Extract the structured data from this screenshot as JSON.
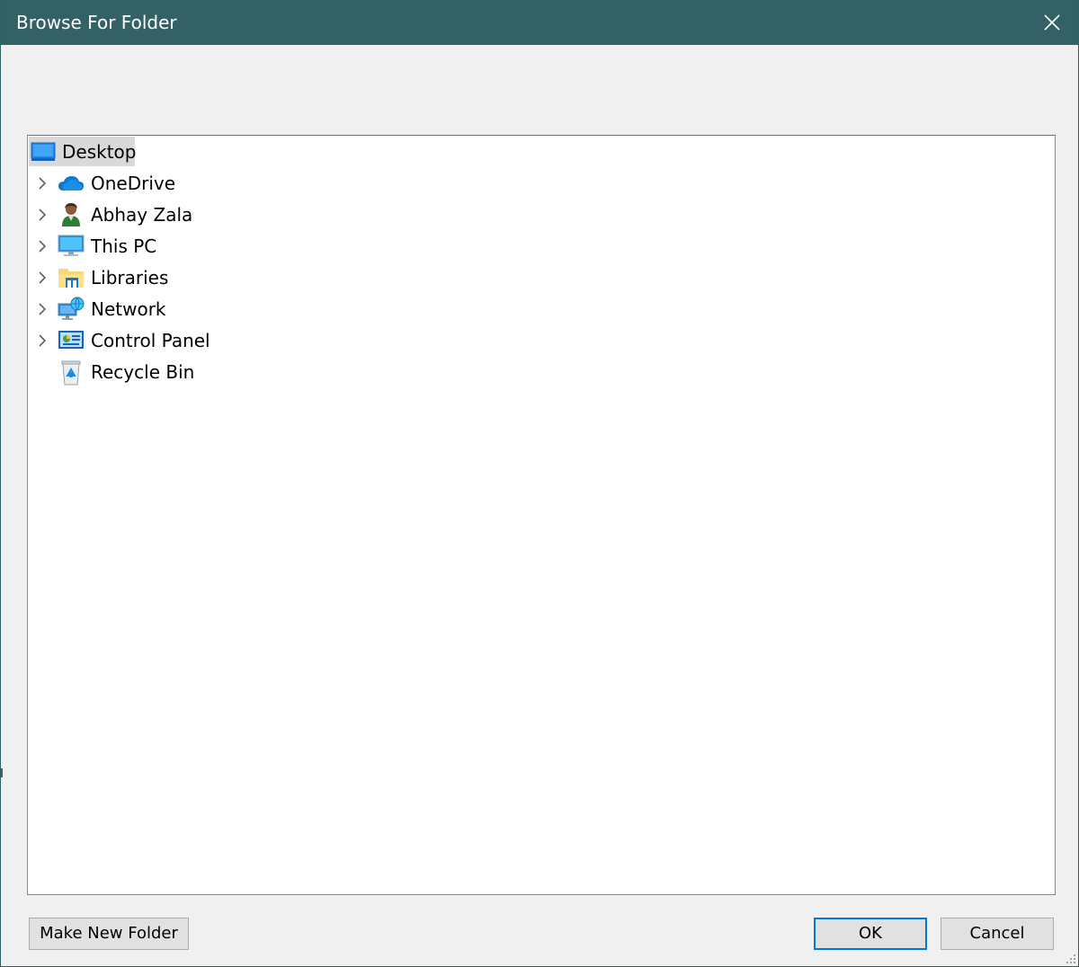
{
  "window": {
    "title": "Browse For Folder",
    "titlebar_color": "#346166"
  },
  "tree": {
    "root": {
      "label": "Desktop",
      "icon": "desktop-icon",
      "selected": true
    },
    "items": [
      {
        "label": "OneDrive",
        "icon": "onedrive-cloud-icon",
        "expandable": true
      },
      {
        "label": "Abhay Zala",
        "icon": "user-icon",
        "expandable": true
      },
      {
        "label": "This PC",
        "icon": "monitor-icon",
        "expandable": true
      },
      {
        "label": "Libraries",
        "icon": "libraries-folder-icon",
        "expandable": true
      },
      {
        "label": "Network",
        "icon": "network-icon",
        "expandable": true
      },
      {
        "label": "Control Panel",
        "icon": "control-panel-icon",
        "expandable": true
      },
      {
        "label": "Recycle Bin",
        "icon": "recycle-bin-icon",
        "expandable": false
      }
    ]
  },
  "buttons": {
    "make_new_folder": "Make New Folder",
    "ok": "OK",
    "cancel": "Cancel"
  },
  "colors": {
    "accent": "#0078d7",
    "selection": "#d9d9d9",
    "dialog_bg": "#f0f0f0"
  }
}
